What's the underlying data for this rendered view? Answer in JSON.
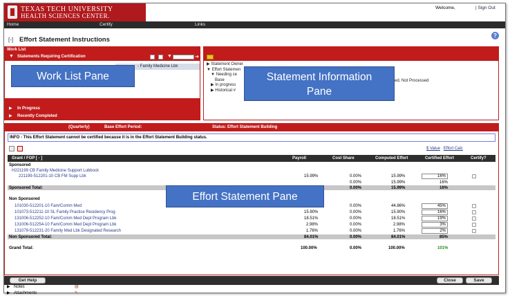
{
  "header": {
    "university_line1": "TEXAS TECH UNIVERSITY",
    "university_line2": "HEALTH SCIENCES CENTER.",
    "welcome": "Welcome,",
    "sign_out": "| Sign Out"
  },
  "nav": {
    "home": "Home",
    "certify": "Certify",
    "links": "Links"
  },
  "page": {
    "collapse": "[-]",
    "title": "Effort Statement Instructions",
    "help": "?"
  },
  "work_list": {
    "title": "Work List",
    "requiring_cert": "Statements Requiring Certification",
    "item": "- Family Medicine Lbk",
    "in_progress": "In Progress",
    "recently_completed": "Recently Completed"
  },
  "statement_info": {
    "tree": [
      "Statement Owner",
      "Effort Statemen",
      "Needing ce",
      "Base",
      "In progress",
      "Historical #"
    ],
    "status_text": "tified. Not Processed"
  },
  "effort_statement": {
    "header_quarterly": "(Quarterly)",
    "header_base_period": "Base Effort Period:",
    "header_status": "Status: Effort Statement Building",
    "info": "INFO - This Effort Statement cannot be certified because it is in the Effort Statement Building status.",
    "link_value": "$ Value",
    "link_calc": "Effort Calc",
    "columns": {
      "grant": "Grant / FOP  [ - ]",
      "payroll": "Payroll",
      "cost_share": "Cost Share",
      "computed": "Computed Effort",
      "certified": "Certified Effort",
      "certify": "Certify?"
    },
    "sponsored_label": "Sponsored",
    "sponsored_group": "H221199  CB Family Medicine Support Lubbock",
    "sponsored_row": {
      "fop": "221199-512201-10  CB FM Supp Lbk",
      "payroll": "15.99%",
      "cost_share": "0.00%",
      "computed": "15.99%",
      "certified": "16%"
    },
    "sponsored_sub": {
      "cost_share": "0.00%",
      "computed": "15.99%",
      "certified": "16%"
    },
    "sponsored_total": {
      "label": "Sponsored Total:",
      "cost_share": "0.00%",
      "computed": "15.99%",
      "certified": "16%"
    },
    "non_sponsored_label": "Non Sponsored",
    "non_sponsored_rows": [
      {
        "fop": "101030-512201-10  Fam/Comm Med",
        "payroll": "",
        "cost_share": "0.00%",
        "computed": "44.86%",
        "certified": "45%"
      },
      {
        "fop": "101073-512211-10  SL Family Practice Residency Prog",
        "payroll": "15.90%",
        "cost_share": "0.00%",
        "computed": "15.90%",
        "certified": "16%"
      },
      {
        "fop": "131006-512252-10  Fam/Comm Med Dept Program Lbk",
        "payroll": "18.51%",
        "cost_share": "0.00%",
        "computed": "18.51%",
        "certified": "19%"
      },
      {
        "fop": "131006-512254-10  Fam/Comm Med Dept Program Lbk",
        "payroll": "2.98%",
        "cost_share": "0.00%",
        "computed": "2.98%",
        "certified": "3%"
      },
      {
        "fop": "131079-512231-20  Family Med Lbk Designated Research",
        "payroll": "1.76%",
        "cost_share": "0.00%",
        "computed": "1.76%",
        "certified": "2%"
      }
    ],
    "non_sponsored_total": {
      "label": "Non Sponsored Total:",
      "payroll": "84.01%",
      "cost_share": "0.00%",
      "computed": "84.01%",
      "certified": "85%"
    },
    "grand_total": {
      "label": "Grand Total:",
      "payroll": "100.00%",
      "cost_share": "0.00%",
      "computed": "100.00%",
      "certified": "101%"
    }
  },
  "buttons": {
    "get_help": "Get Help",
    "close": "Close",
    "save": "Save"
  },
  "footer": {
    "notes": "Notes",
    "attachments": "Attachments"
  },
  "callouts": {
    "work_list": "Work List Pane",
    "statement_info_l1": "Statement Information",
    "statement_info_l2": "Pane",
    "effort_statement": "Effort Statement Pane"
  },
  "colors": {
    "brand_red": "#c21b1b",
    "callout_blue": "#4472c4",
    "dark_bar": "#2e2e2e"
  }
}
